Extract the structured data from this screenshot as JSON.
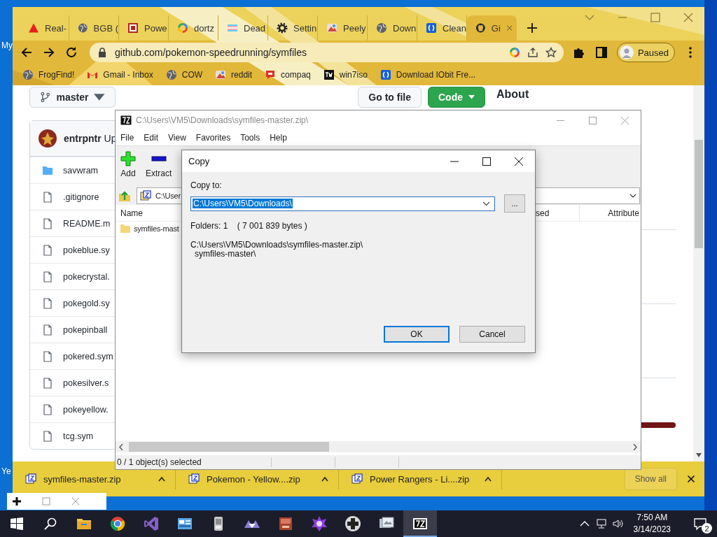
{
  "desktop": {
    "labels": [
      "My",
      "Ye"
    ]
  },
  "browser": {
    "tabs": [
      {
        "title": "Real-",
        "selected": false
      },
      {
        "title": "BGB (",
        "selected": false
      },
      {
        "title": "Powe",
        "selected": false
      },
      {
        "title": "dortz",
        "selected": false
      },
      {
        "title": "Dead",
        "selected": false
      },
      {
        "title": "Settin",
        "selected": false
      },
      {
        "title": "Peely",
        "selected": false
      },
      {
        "title": "Down",
        "selected": false
      },
      {
        "title": "Clean",
        "selected": false
      },
      {
        "title": "Gi",
        "selected": true
      }
    ],
    "address": "github.com/pokemon-speedrunning/symfiles",
    "profile": "Paused",
    "bookmarks": [
      "FrogFind!",
      "Gmail - Inbox",
      "COW",
      "reddit",
      "compaq",
      "win7iso",
      "Download IObit Fre..."
    ],
    "page": {
      "branch": "master",
      "go_to_file": "Go to file",
      "code": "Code",
      "about": "About",
      "commit": "**entrpntr** Up",
      "files": [
        {
          "name": "savwram",
          "kind": "folder"
        },
        {
          "name": ".gitignore",
          "kind": "file"
        },
        {
          "name": "README.m",
          "kind": "file"
        },
        {
          "name": "pokeblue.sy",
          "kind": "file"
        },
        {
          "name": "pokecrystal.",
          "kind": "file"
        },
        {
          "name": "pokegold.sy",
          "kind": "file"
        },
        {
          "name": "pokepinball",
          "kind": "file"
        },
        {
          "name": "pokered.sym",
          "kind": "file"
        },
        {
          "name": "pokesilver.s",
          "kind": "file"
        },
        {
          "name": "pokeyellow.",
          "kind": "file"
        },
        {
          "name": "tcg.sym",
          "kind": "file"
        }
      ]
    },
    "downloads": {
      "items": [
        "symfiles-master.zip",
        "Pokemon - Yellow....zip",
        "Power Rangers - Li....zip"
      ],
      "show_all": "Show all"
    }
  },
  "archive": {
    "title": "C:\\Users\\VM5\\Downloads\\symfiles-master.zip\\",
    "menu": [
      "File",
      "Edit",
      "View",
      "Favorites",
      "Tools",
      "Help"
    ],
    "tools": [
      "Add",
      "Extract"
    ],
    "path": "C:\\User",
    "columns": [
      "Name",
      "sed",
      "Attribute"
    ],
    "rows": [
      "symfiles-mast"
    ],
    "status": "0 / 1 object(s) selected"
  },
  "copy_dialog": {
    "title": "Copy",
    "label": "Copy to:",
    "value": "C:\\Users\\VM5\\Downloads\\",
    "browse": "...",
    "summary": "Folders: 1    ( 7 001 839 bytes )",
    "source": [
      "C:\\Users\\VM5\\Downloads\\symfiles-master.zip\\",
      "symfiles-master\\"
    ],
    "buttons": [
      {
        "label": "OK",
        "default": true
      },
      {
        "label": "Cancel",
        "default": false
      }
    ]
  },
  "taskbar": {
    "apps": [
      {
        "selected": false
      },
      {
        "selected": false
      },
      {
        "selected": false
      },
      {
        "selected": false
      },
      {
        "selected": false
      },
      {
        "selected": false
      },
      {
        "selected": false
      },
      {
        "selected": false
      },
      {
        "selected": false
      },
      {
        "selected": false
      },
      {
        "selected": true
      }
    ],
    "time": "7:50 AM",
    "date": "3/14/2023",
    "notifications": "2"
  }
}
